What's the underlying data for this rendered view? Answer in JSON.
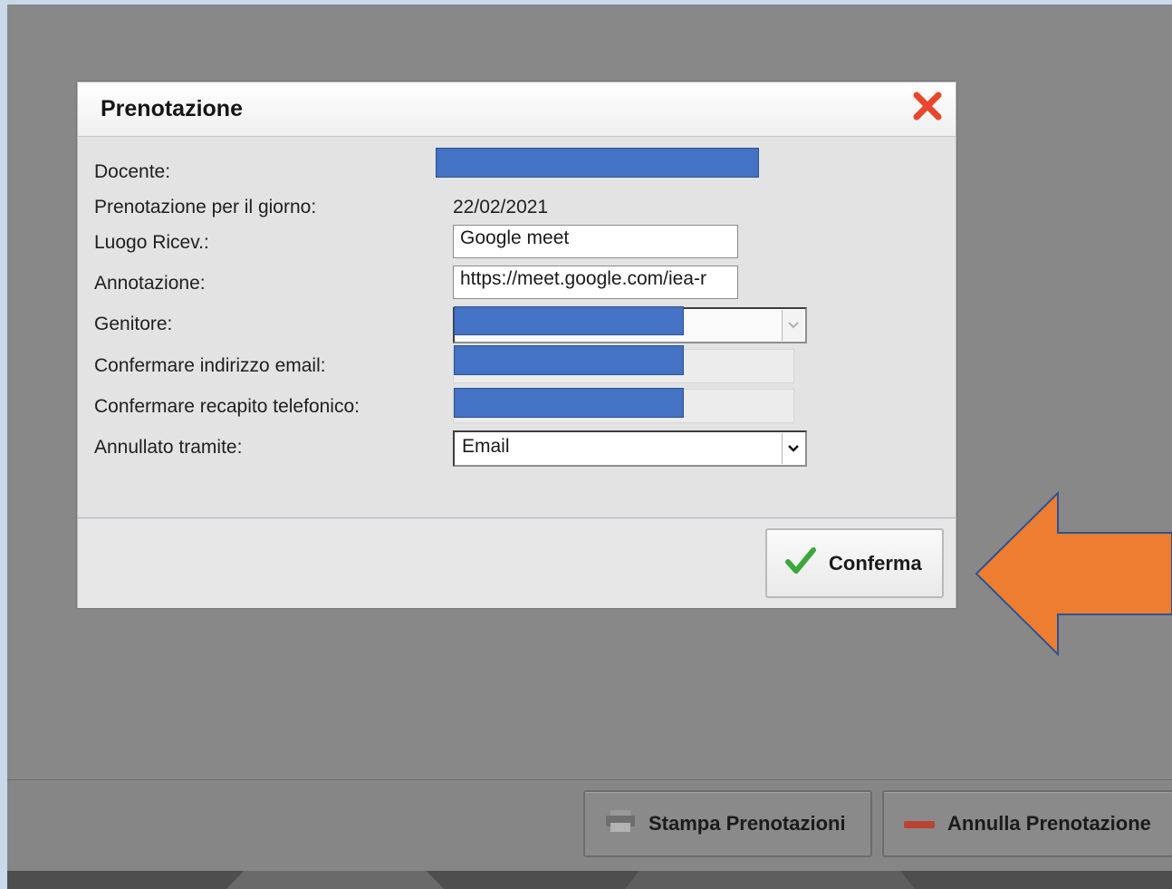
{
  "dialog": {
    "title": "Prenotazione",
    "fields": {
      "docente_label": "Docente:",
      "giorno_label": "Prenotazione per il giorno:",
      "giorno_value": "22/02/2021",
      "luogo_label": "Luogo Ricev.:",
      "luogo_value": "Google meet",
      "annotazione_label": "Annotazione:",
      "annotazione_value": "https://meet.google.com/iea-r",
      "genitore_label": "Genitore:",
      "email_label": "Confermare indirizzo email:",
      "telefono_label": "Confermare recapito telefonico:",
      "annullato_label": "Annullato tramite:",
      "annullato_value": "Email"
    },
    "confirm_label": "Conferma"
  },
  "toolbar": {
    "print_label": "Stampa Prenotazioni",
    "cancel_label": "Annulla Prenotazione"
  },
  "icons": {
    "close": "close-icon",
    "check": "check-icon",
    "printer": "printer-icon",
    "minus": "minus-icon"
  },
  "colors": {
    "redaction": "#4472c4",
    "arrow": "#ed7d31",
    "close": "#e8462d",
    "check": "#3aa83a"
  }
}
